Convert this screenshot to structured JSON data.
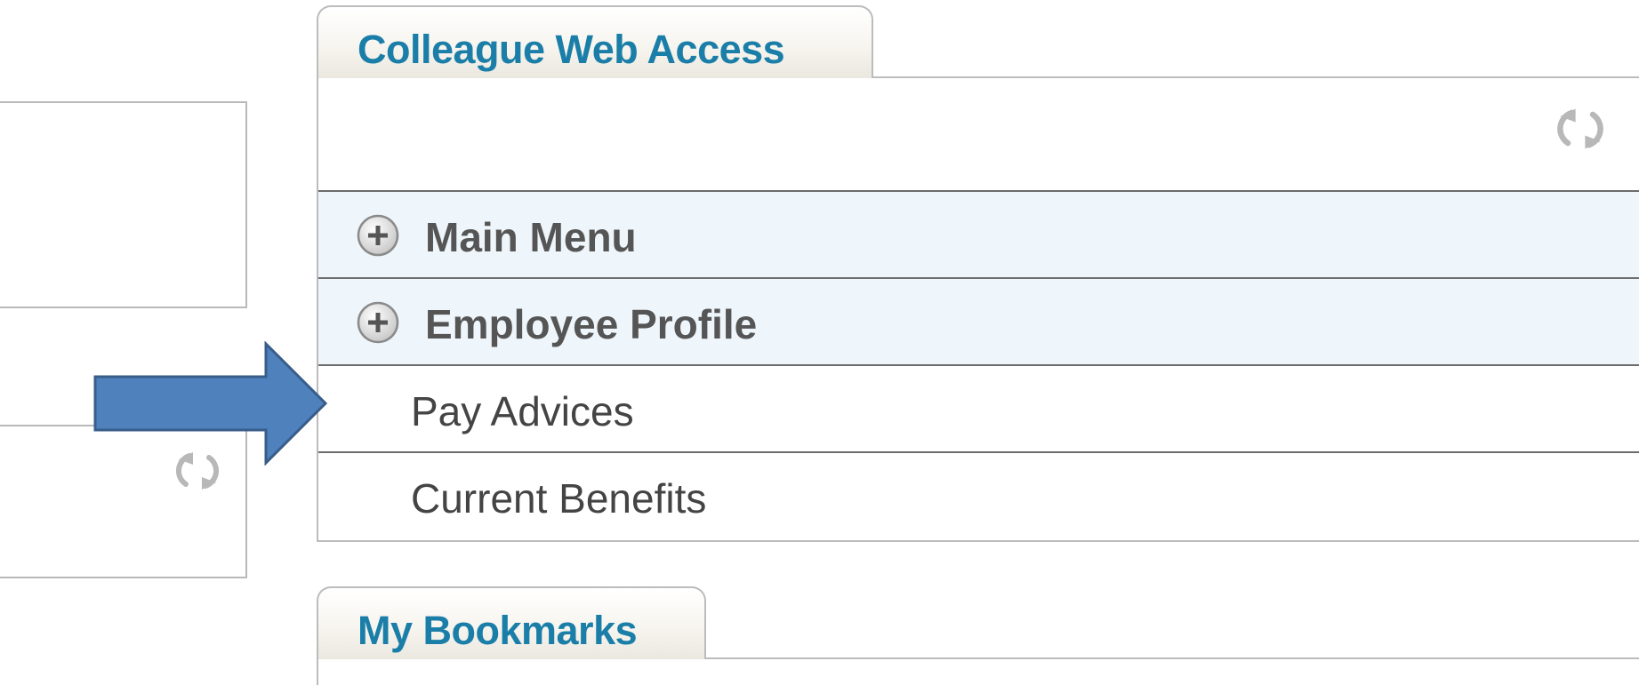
{
  "colleague_web_access": {
    "title": "Colleague Web Access",
    "menu": [
      {
        "label": "Main Menu",
        "icon": "plus-circle-icon",
        "type": "section"
      },
      {
        "label": "Employee Profile",
        "icon": "plus-circle-icon",
        "type": "section"
      },
      {
        "label": "Pay Advices",
        "type": "link"
      },
      {
        "label": "Current Benefits",
        "type": "link"
      }
    ]
  },
  "my_bookmarks": {
    "title": "My Bookmarks"
  },
  "colors": {
    "tab_title": "#1a7ea8",
    "section_background": "#eef6fc",
    "arrow_fill": "#4f81bd",
    "arrow_stroke": "#385d8a"
  }
}
